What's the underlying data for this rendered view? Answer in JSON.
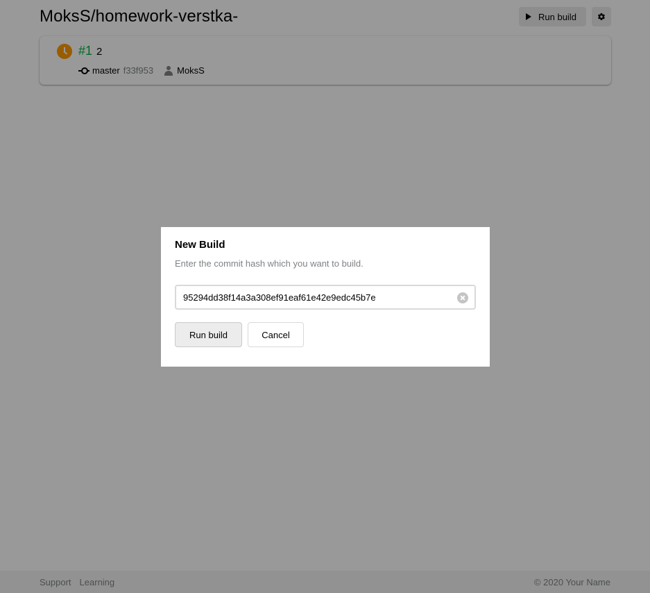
{
  "header": {
    "repo_title": "MoksS/homework-verstka-",
    "run_build_label": "Run build",
    "settings_icon": "gear-icon"
  },
  "build_card": {
    "status": "pending",
    "status_color": "#ff9a00",
    "number": "#1",
    "message": "2",
    "branch": "master",
    "commit_hash": "f33f953",
    "author": "MoksS",
    "number_color": "#00b341"
  },
  "modal": {
    "title": "New Build",
    "subtitle": "Enter the commit hash which you want to build.",
    "input_value": "95294dd38f14a3a308ef91eaf61e42e9edc45b7e",
    "run_label": "Run build",
    "cancel_label": "Cancel"
  },
  "footer": {
    "links": [
      "Support",
      "Learning"
    ],
    "copyright": "© 2020 Your Name"
  }
}
